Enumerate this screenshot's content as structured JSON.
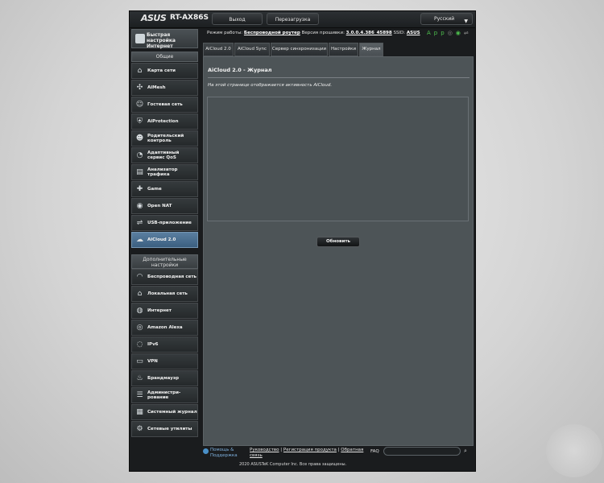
{
  "topbar": {
    "brand": "ASUS",
    "model": "RT-AX86S",
    "logout_label": "Выход",
    "reboot_label": "Перезагрузка",
    "language": "Русский"
  },
  "status": {
    "mode_label": "Режим работы:",
    "mode_value": "Беспроводной роутер",
    "firmware_label": "Версия прошивки:",
    "firmware_value": "3.0.0.4.386_45898",
    "ssid_label": "SSID:",
    "ssid_value": "ASUS",
    "app_label": "App"
  },
  "sidebar": {
    "quick_setup": "Быстрая настройка Интернет",
    "general_header": "Общие",
    "general_items": [
      {
        "label": "Карта сети",
        "icon": "network-map-icon"
      },
      {
        "label": "AiMesh",
        "icon": "aimesh-icon"
      },
      {
        "label": "Гостевая сеть",
        "icon": "guest-network-icon"
      },
      {
        "label": "AiProtection",
        "icon": "shield-icon"
      },
      {
        "label": "Родительский контроль",
        "icon": "parental-control-icon"
      },
      {
        "label": "Адаптивный сервис QoS",
        "icon": "qos-icon"
      },
      {
        "label": "Анализатор трафика",
        "icon": "traffic-analyzer-icon"
      },
      {
        "label": "Game",
        "icon": "gamepad-icon"
      },
      {
        "label": "Open NAT",
        "icon": "open-nat-icon"
      },
      {
        "label": "USB-приложение",
        "icon": "usb-icon"
      },
      {
        "label": "AiCloud 2.0",
        "icon": "cloud-icon"
      }
    ],
    "advanced_header": "Дополнительные настройки",
    "advanced_items": [
      {
        "label": "Беспроводная сеть",
        "icon": "wireless-icon"
      },
      {
        "label": "Локальная сеть",
        "icon": "lan-icon"
      },
      {
        "label": "Интернет",
        "icon": "globe-icon"
      },
      {
        "label": "Amazon Alexa",
        "icon": "alexa-icon"
      },
      {
        "label": "IPv6",
        "icon": "ipv6-icon"
      },
      {
        "label": "VPN",
        "icon": "vpn-icon"
      },
      {
        "label": "Брандмауэр",
        "icon": "firewall-icon"
      },
      {
        "label": "Администри-рование",
        "icon": "admin-icon"
      },
      {
        "label": "Системный журнал",
        "icon": "system-log-icon"
      },
      {
        "label": "Сетевые утилиты",
        "icon": "network-tools-icon"
      }
    ]
  },
  "tabs": [
    {
      "label": "AiCloud 2.0"
    },
    {
      "label": "AiCloud Sync"
    },
    {
      "label": "Сервер синхронизации"
    },
    {
      "label": "Настройки"
    },
    {
      "label": "Журнал"
    }
  ],
  "main": {
    "title": "AiCloud 2.0 - Журнал",
    "description": "На этой странице отображается активность AiCloud.",
    "log_content": "",
    "refresh_label": "Обновить"
  },
  "footer": {
    "help": "Помощь & Поддержка",
    "manual": "Руководство",
    "register": "Регистрация продукта",
    "feedback": "Обратная связь",
    "faq": "FAQ",
    "copyright": "2020 ASUSTeK Computer Inc. Все права защищены."
  }
}
